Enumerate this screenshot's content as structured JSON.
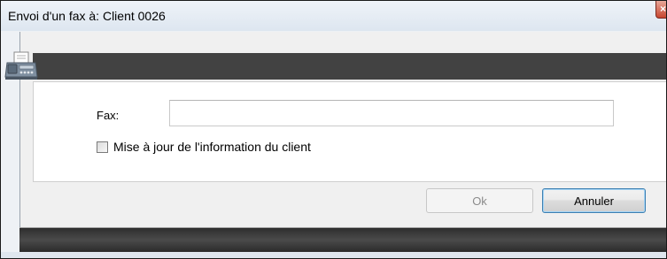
{
  "window": {
    "title": "Envoi d'un fax à: Client 0026",
    "close_glyph": "×"
  },
  "form": {
    "fax_label": "Fax:",
    "fax_value": "",
    "fax_placeholder": "",
    "update_checkbox_label": "Mise à jour de l'information du client",
    "update_checkbox_checked": false,
    "icon": "fax-machine-icon"
  },
  "buttons": {
    "ok_label": "Ok",
    "ok_enabled": false,
    "cancel_label": "Annuler"
  },
  "colors": {
    "header_bar": "#424242",
    "bottom_bar": "#3a3a3a",
    "cancel_border": "#3c7fb1"
  }
}
